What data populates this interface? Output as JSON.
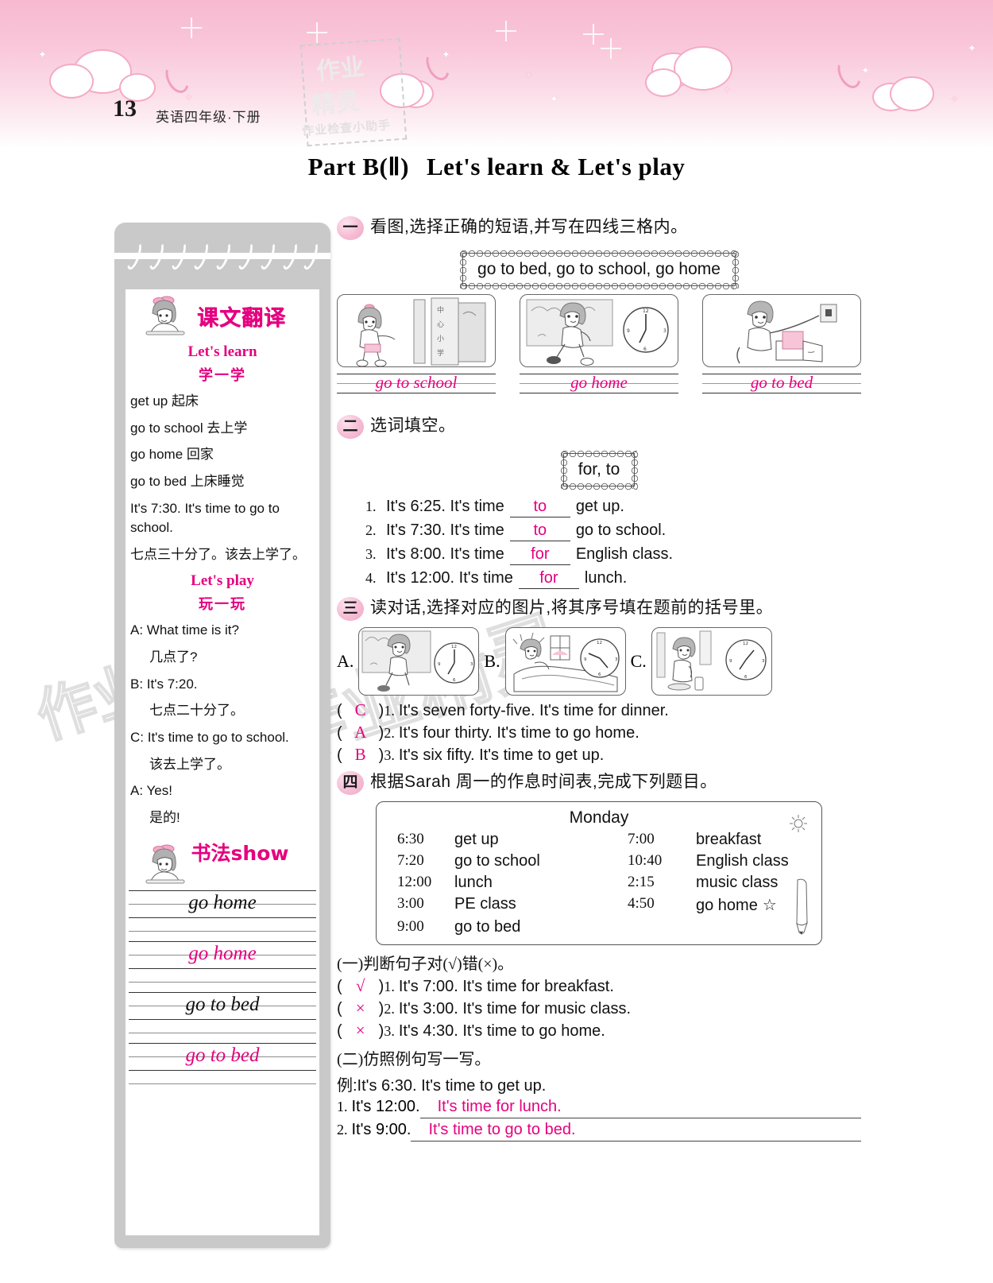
{
  "header": {
    "page_number": "13",
    "book_title": "英语四年级·下册",
    "stamp_line1": "作业",
    "stamp_line2": "精灵",
    "stamp_line3": "作业检查小助手"
  },
  "main_heading": {
    "part": "Part B(Ⅱ)",
    "topic": "Let's learn  &  Let's play"
  },
  "sidebar": {
    "translation_title": "课文翻译",
    "section1_en": "Let's learn",
    "section1_cn": "学一学",
    "vocab": [
      "get up 起床",
      "go to school 去上学",
      "go home 回家",
      "go to bed 上床睡觉"
    ],
    "sentence_en": "It's 7:30. It's time to go to school.",
    "sentence_cn": "七点三十分了。该去上学了。",
    "section2_en": "Let's play",
    "section2_cn": "玩一玩",
    "dialogue": [
      {
        "speaker": "A: What time is it?",
        "cn": "几点了?"
      },
      {
        "speaker": "B: It's 7:20.",
        "cn": "七点二十分了。"
      },
      {
        "speaker": "C: It's time to go to school.",
        "cn": "该去上学了。"
      },
      {
        "speaker": "A: Yes!",
        "cn": "是的!"
      }
    ],
    "calligraphy_title": "书法show",
    "calligraphy_rows": [
      {
        "text": "go home",
        "ink": "black"
      },
      {
        "text": "go home",
        "ink": "pink"
      },
      {
        "text": "go to bed",
        "ink": "black"
      },
      {
        "text": "go to bed",
        "ink": "pink"
      }
    ]
  },
  "exercises": {
    "ex1": {
      "number": "一",
      "instruction": "看图,选择正确的短语,并写在四线三格内。",
      "wordbank": "go to bed, go to school, go home",
      "items": [
        {
          "scene": "girl-at-school-gate",
          "answer": "go to school"
        },
        {
          "scene": "boy-running-home-clock",
          "answer": "go home"
        },
        {
          "scene": "boy-at-bed-lamp",
          "answer": "go to bed"
        }
      ]
    },
    "ex2": {
      "number": "二",
      "instruction": "选词填空。",
      "wordbank": "for, to",
      "items": [
        {
          "no": "1.",
          "before": "It's 6:25. It's time",
          "answer": "to",
          "after": "get up."
        },
        {
          "no": "2.",
          "before": "It's 7:30. It's time",
          "answer": "to",
          "after": "go to school."
        },
        {
          "no": "3.",
          "before": "It's 8:00. It's time",
          "answer": "for",
          "after": "English class."
        },
        {
          "no": "4.",
          "before": "It's 12:00. It's time",
          "answer": "for",
          "after": "lunch."
        }
      ]
    },
    "ex3": {
      "number": "三",
      "instruction": "读对话,选择对应的图片,将其序号填在题前的括号里。",
      "choices": [
        {
          "label": "A.",
          "scene": "boy-running-clock-145"
        },
        {
          "label": "B.",
          "scene": "boy-in-bed-window-clock-650"
        },
        {
          "label": "C.",
          "scene": "boy-eating-clock-745"
        }
      ],
      "items": [
        {
          "answer": "C",
          "no": "1.",
          "text": "It's seven forty-five. It's time for dinner."
        },
        {
          "answer": "A",
          "no": "2.",
          "text": "It's four thirty. It's time to go home."
        },
        {
          "answer": "B",
          "no": "3.",
          "text": "It's six fifty. It's time to get up."
        }
      ]
    },
    "ex4": {
      "number": "四",
      "instruction": "根据Sarah 周一的作息时间表,完成下列题目。",
      "schedule": {
        "title": "Monday",
        "rows": [
          {
            "t1": "6:30",
            "a1": "get up",
            "t2": "7:00",
            "a2": "breakfast"
          },
          {
            "t1": "7:20",
            "a1": "go to school",
            "t2": "10:40",
            "a2": "English class"
          },
          {
            "t1": "12:00",
            "a1": "lunch",
            "t2": "2:15",
            "a2": "music class"
          },
          {
            "t1": "3:00",
            "a1": "PE class",
            "t2": "4:50",
            "a2": "go home"
          },
          {
            "t1": "9:00",
            "a1": "go to bed",
            "t2": "",
            "a2": ""
          }
        ]
      },
      "part1_head": "(一)判断句子对(√)错(×)。",
      "part1_items": [
        {
          "answer": "√",
          "no": "1.",
          "text": "It's 7:00. It's time for breakfast."
        },
        {
          "answer": "×",
          "no": "2.",
          "text": "It's 3:00. It's time for music class."
        },
        {
          "answer": "×",
          "no": "3.",
          "text": "It's 4:30. It's time to go home."
        }
      ],
      "part2_head": "(二)仿照例句写一写。",
      "example": "例:It's 6:30. It's time to get up.",
      "part2_items": [
        {
          "no": "1.",
          "prompt": "It's 12:00.",
          "answer": "It's time for lunch."
        },
        {
          "no": "2.",
          "prompt": "It's 9:00.",
          "answer": "It's time to go to bed."
        }
      ]
    }
  },
  "colors": {
    "answer_pink": "#e5007f",
    "banner_pink": "#f7b9cf",
    "notepad_gray": "#c9c9c9"
  },
  "watermark": "作业精灵"
}
